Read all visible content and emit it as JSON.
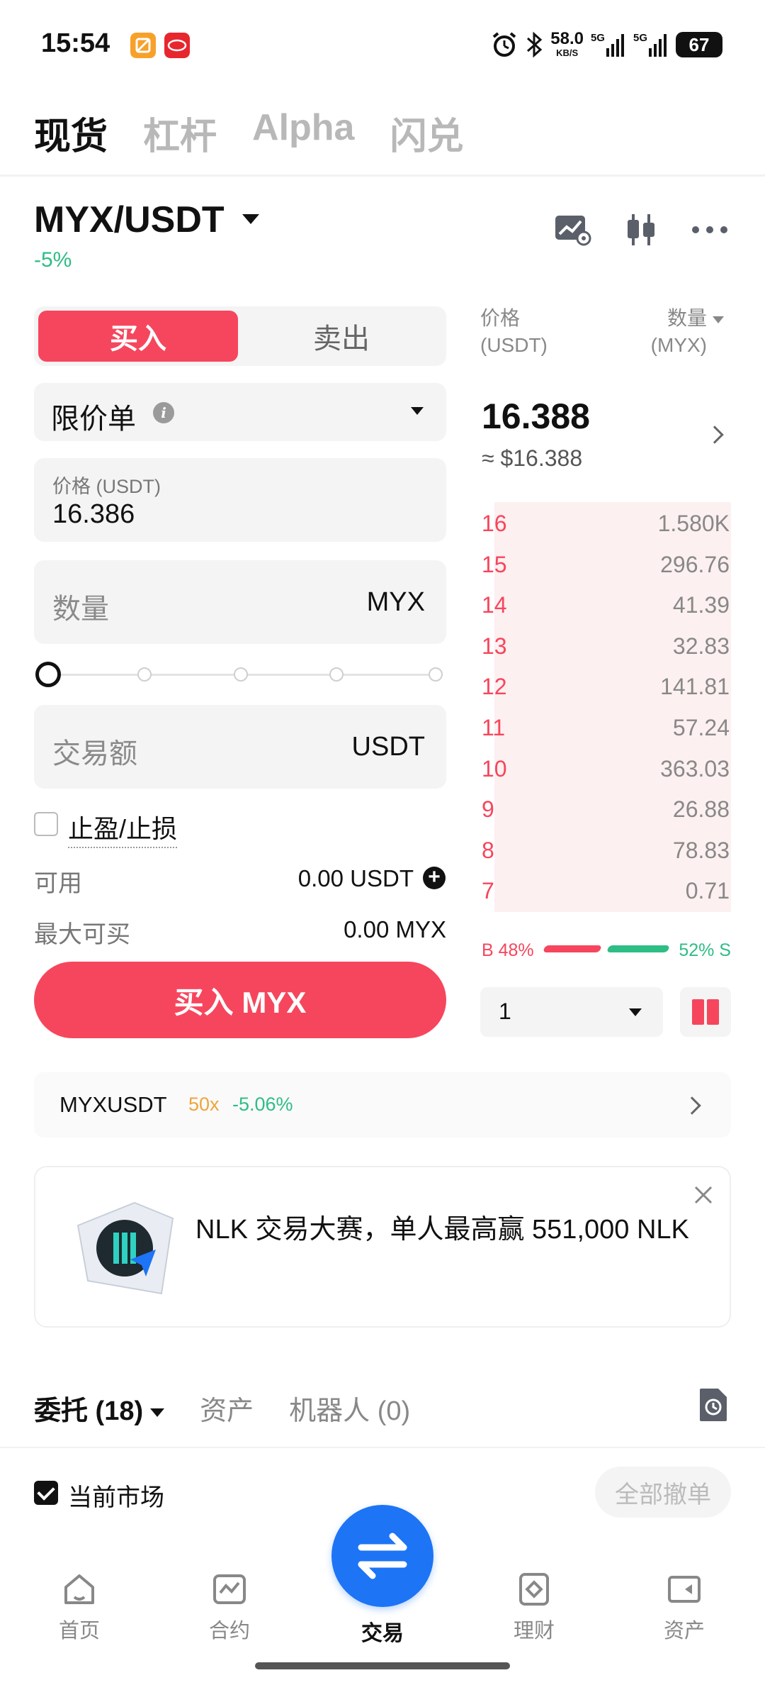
{
  "status_bar": {
    "time": "15:54",
    "net_speed": "58.0",
    "net_unit": "KB/S",
    "signal1_label": "5G",
    "signal2_label": "5G",
    "battery": "67"
  },
  "top_tabs": [
    "现货",
    "杠杆",
    "Alpha",
    "闪兑"
  ],
  "pair": {
    "symbol": "MYX/USDT",
    "change": "-5%"
  },
  "order_form": {
    "buy_tab": "买入",
    "sell_tab": "卖出",
    "order_type": "限价单",
    "price_label": "价格 (USDT)",
    "price_value": "16.386",
    "qty_placeholder": "数量",
    "qty_unit": "MYX",
    "amount_placeholder": "交易额",
    "amount_unit": "USDT",
    "slider_percent": 0,
    "tpsl_label": "止盈/止损",
    "available_label": "可用",
    "available_value": "0.00 USDT",
    "max_buy_label": "最大可买",
    "max_buy_value": "0.00 MYX",
    "buy_button": "买入 MYX"
  },
  "order_book": {
    "price_header": "价格",
    "price_unit": "(USDT)",
    "qty_header": "数量",
    "qty_unit": "(MYX)",
    "last_price": "16.388",
    "last_price_usd": "≈ $16.388",
    "asks": [
      {
        "price": "16",
        "qty": "1.580K"
      },
      {
        "price": "15",
        "qty": "296.76"
      },
      {
        "price": "14",
        "qty": "41.39"
      },
      {
        "price": "13",
        "qty": "32.83"
      },
      {
        "price": "12",
        "qty": "141.81"
      },
      {
        "price": "11",
        "qty": "57.24"
      },
      {
        "price": "10",
        "qty": "363.03"
      },
      {
        "price": "9",
        "qty": "26.88"
      },
      {
        "price": "8",
        "qty": "78.83"
      },
      {
        "price": "7",
        "qty": "0.71"
      }
    ],
    "buy_ratio": "B 48%",
    "sell_ratio": "52% S",
    "depth": "1"
  },
  "futures": {
    "symbol": "MYXUSDT",
    "leverage": "50x",
    "change": "-5.06%"
  },
  "banner": {
    "text": "NLK 交易大赛，单人最高赢 551,000 NLK"
  },
  "orders": {
    "tabs": [
      "委托 (18)",
      "资产",
      "机器人 (0)"
    ],
    "current_market": "当前市场",
    "cancel_all": "全部撤单"
  },
  "bottom_nav": [
    "首页",
    "合约",
    "交易",
    "理财",
    "资产"
  ],
  "colors": {
    "red": "#f6465d",
    "green": "#2ebd85",
    "blue": "#1d74f5",
    "orange": "#f0a43a"
  }
}
